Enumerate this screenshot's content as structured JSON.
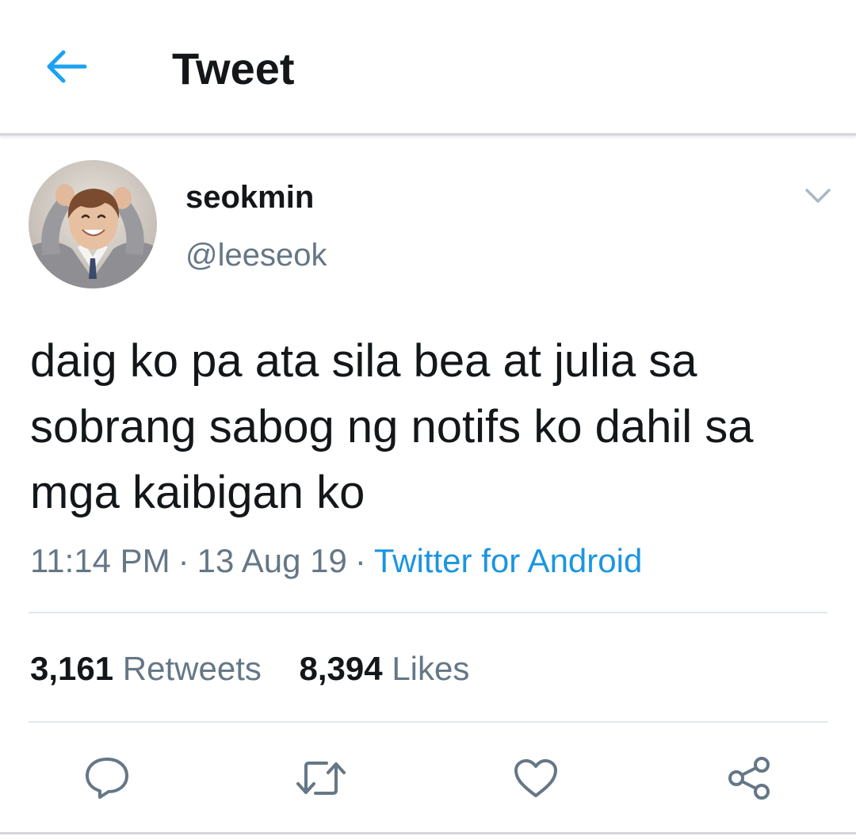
{
  "appbar": {
    "title": "Tweet",
    "back_icon": "back-arrow-icon",
    "accent_color": "#1da1f2"
  },
  "tweet": {
    "display_name": "seokmin",
    "handle": "@leeseok",
    "text": "daig ko pa ata sila bea at julia sa sobrang sabog ng notifs ko dahil sa mga kaibigan ko",
    "time": "11:14 PM",
    "date": "13 Aug 19",
    "separator": "·",
    "source": "Twitter for Android",
    "source_color": "#1b95e0"
  },
  "stats": {
    "retweets_count": "3,161",
    "retweets_label": "Retweets",
    "likes_count": "8,394",
    "likes_label": "Likes"
  },
  "actions": {
    "reply_icon": "reply-icon",
    "retweet_icon": "retweet-icon",
    "like_icon": "heart-icon",
    "share_icon": "share-icon"
  }
}
